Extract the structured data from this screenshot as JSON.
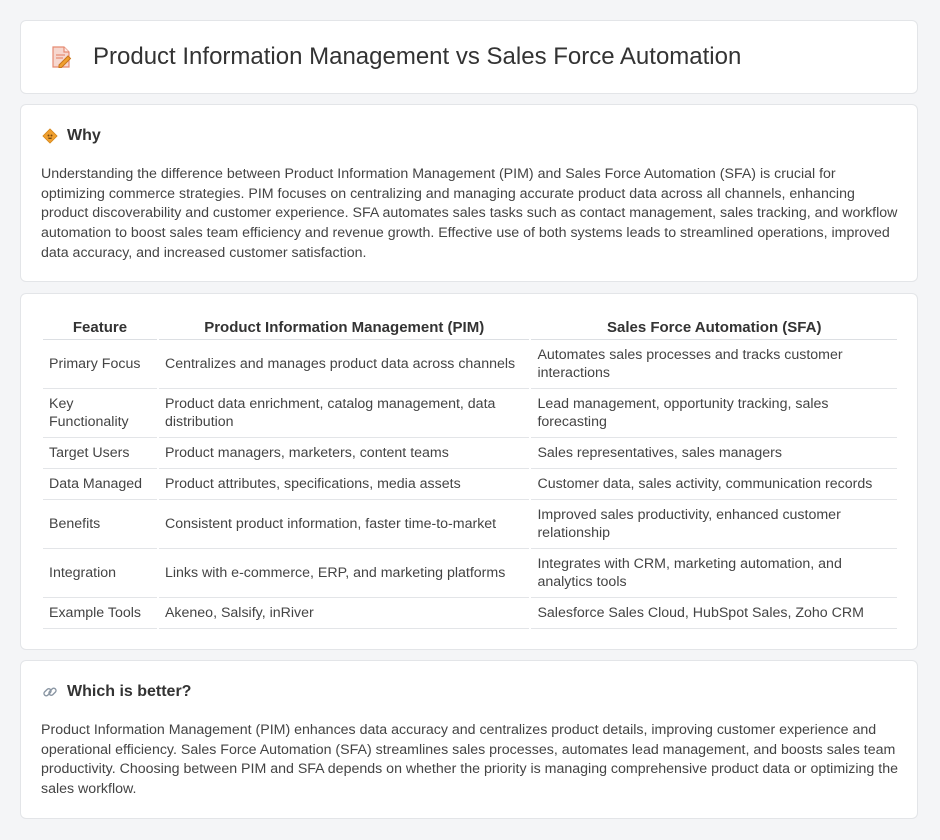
{
  "header": {
    "title": "Product Information Management vs Sales Force Automation",
    "icon": "document-pencil-icon"
  },
  "why": {
    "heading": "Why",
    "icon": "diamond-sign-icon",
    "text": "Understanding the difference between Product Information Management (PIM) and Sales Force Automation (SFA) is crucial for optimizing commerce strategies. PIM focuses on centralizing and managing accurate product data across all channels, enhancing product discoverability and customer experience. SFA automates sales tasks such as contact management, sales tracking, and workflow automation to boost sales team efficiency and revenue growth. Effective use of both systems leads to streamlined operations, improved data accuracy, and increased customer satisfaction."
  },
  "comparison": {
    "headers": [
      "Feature",
      "Product Information Management (PIM)",
      "Sales Force Automation (SFA)"
    ],
    "rows": [
      [
        "Primary Focus",
        "Centralizes and manages product data across channels",
        "Automates sales processes and tracks customer interactions"
      ],
      [
        "Key Functionality",
        "Product data enrichment, catalog management, data distribution",
        "Lead management, opportunity tracking, sales forecasting"
      ],
      [
        "Target Users",
        "Product managers, marketers, content teams",
        "Sales representatives, sales managers"
      ],
      [
        "Data Managed",
        "Product attributes, specifications, media assets",
        "Customer data, sales activity, communication records"
      ],
      [
        "Benefits",
        "Consistent product information, faster time-to-market",
        "Improved sales productivity, enhanced customer relationship"
      ],
      [
        "Integration",
        "Links with e-commerce, ERP, and marketing platforms",
        "Integrates with CRM, marketing automation, and analytics tools"
      ],
      [
        "Example Tools",
        "Akeneo, Salsify, inRiver",
        "Salesforce Sales Cloud, HubSpot Sales, Zoho CRM"
      ]
    ]
  },
  "better": {
    "heading": "Which is better?",
    "icon": "link-icon",
    "text": "Product Information Management (PIM) enhances data accuracy and centralizes product details, improving customer experience and operational efficiency. Sales Force Automation (SFA) streamlines sales processes, automates lead management, and boosts sales team productivity. Choosing between PIM and SFA depends on whether the priority is managing comprehensive product data or optimizing the sales workflow."
  },
  "colors": {
    "background": "#f4f5f7",
    "card": "#ffffff",
    "border": "#e3e5e8",
    "accent_orange": "#f0a030",
    "icon_pink": "#e87060"
  }
}
